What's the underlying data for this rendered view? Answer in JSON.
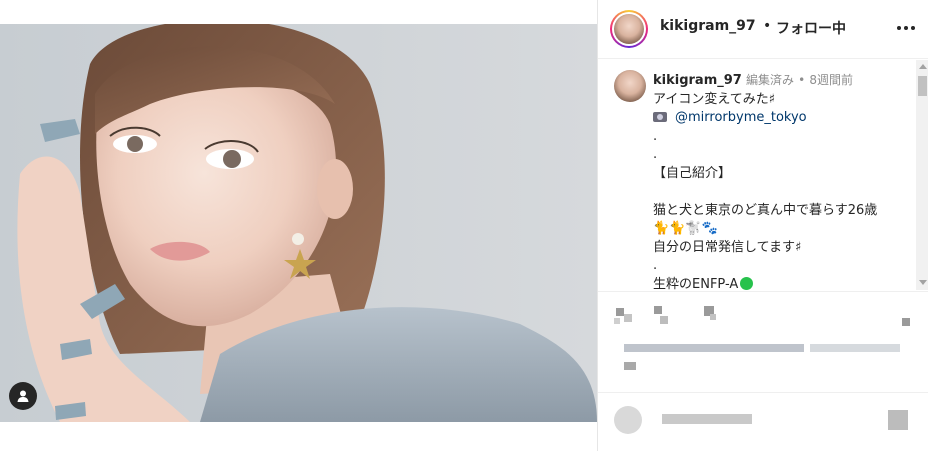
{
  "post": {
    "username": "kikigram_97",
    "separator": "•",
    "follow_state": "フォロー中"
  },
  "caption": {
    "username": "kikigram_97",
    "edited": "編集済み",
    "dot": "•",
    "time_ago": "8週間前",
    "lines": [
      "アイコン変えてみた♯",
      "@mirrorbyme_tokyo",
      ".",
      ".",
      "【自己紹介】",
      "",
      "猫と犬と東京のど真ん中で暮らす26歳",
      "🐈🐈🐩🐾",
      "自分の日常発信してます♯",
      ".",
      "生粋のENFP-A"
    ]
  },
  "icons": {
    "more": "more-horizontal-icon",
    "user_tag": "user-tag-icon",
    "camera": "camera-emoji-icon",
    "status_dot": "green-circle-emoji-icon"
  },
  "colors": {
    "link": "#00376b",
    "meta": "#8e8e8e",
    "text": "#262626",
    "green_dot": "#27c24c"
  }
}
